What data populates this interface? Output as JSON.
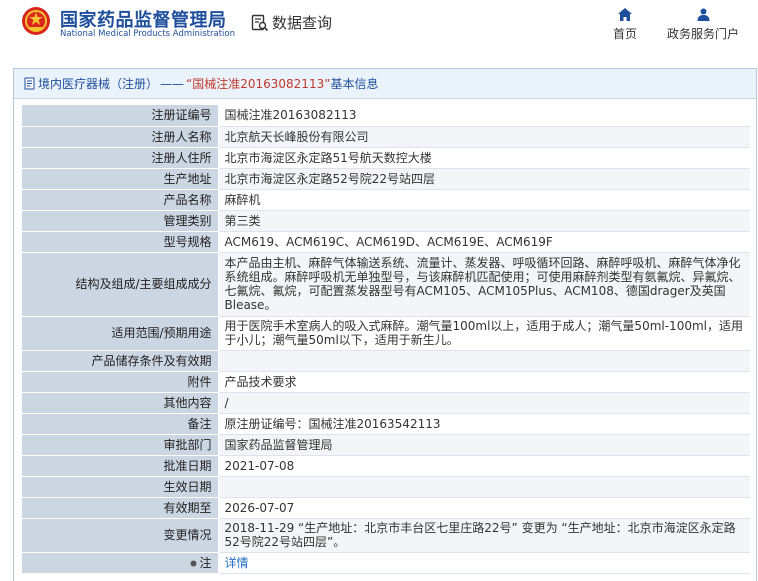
{
  "header": {
    "logo_cn": "国家药品监督管理局",
    "logo_en": "National Medical Products Administration",
    "query_label": "数据查询",
    "nav_home": "首页",
    "nav_service": "政务服务门户"
  },
  "title": {
    "category": "境内医疗器械（注册）",
    "separator": "——",
    "reg_quoted": "“国械注准20163082113”",
    "suffix": "基本信息"
  },
  "fields": [
    {
      "key": "注册证编号",
      "value": "国械注准20163082113"
    },
    {
      "key": "注册人名称",
      "value": "北京航天长峰股份有限公司"
    },
    {
      "key": "注册人住所",
      "value": "北京市海淀区永定路51号航天数控大楼"
    },
    {
      "key": "生产地址",
      "value": "北京市海淀区永定路52号院22号站四层"
    },
    {
      "key": "产品名称",
      "value": "麻醉机"
    },
    {
      "key": "管理类别",
      "value": "第三类"
    },
    {
      "key": "型号规格",
      "value": "ACM619、ACM619C、ACM619D、ACM619E、ACM619F"
    },
    {
      "key": "结构及组成/主要组成成分",
      "value": "本产品由主机、麻醉气体输送系统、流量计、蒸发器、呼吸循环回路、麻醉呼吸机、麻醉气体净化系统组成。麻醉呼吸机无单独型号，与该麻醉机匹配使用；可使用麻醉剂类型有氨氟烷、异氟烷、七氟烷、氟烷，可配置蒸发器型号有ACM105、ACM105Plus、ACM108、德国drager及英国Blease。"
    },
    {
      "key": "适用范围/预期用途",
      "value": "用于医院手术室病人的吸入式麻醉。潮气量100ml以上，适用于成人；潮气量50ml-100ml，适用于小儿；潮气量50ml以下，适用于新生儿。"
    },
    {
      "key": "产品储存条件及有效期",
      "value": ""
    },
    {
      "key": "附件",
      "value": "产品技术要求"
    },
    {
      "key": "其他内容",
      "value": "/"
    },
    {
      "key": "备注",
      "value": "原注册证编号：国械注准20163542113"
    },
    {
      "key": "审批部门",
      "value": "国家药品监督管理局"
    },
    {
      "key": "批准日期",
      "value": "2021-07-08"
    },
    {
      "key": "生效日期",
      "value": ""
    },
    {
      "key": "有效期至",
      "value": "2026-07-07"
    },
    {
      "key": "变更情况",
      "value": "2018-11-29 “生产地址：北京市丰台区七里庄路22号” 变更为 “生产地址：北京市海淀区永定路52号院22号站四层”。"
    },
    {
      "key": "注",
      "value": "详情"
    }
  ]
}
